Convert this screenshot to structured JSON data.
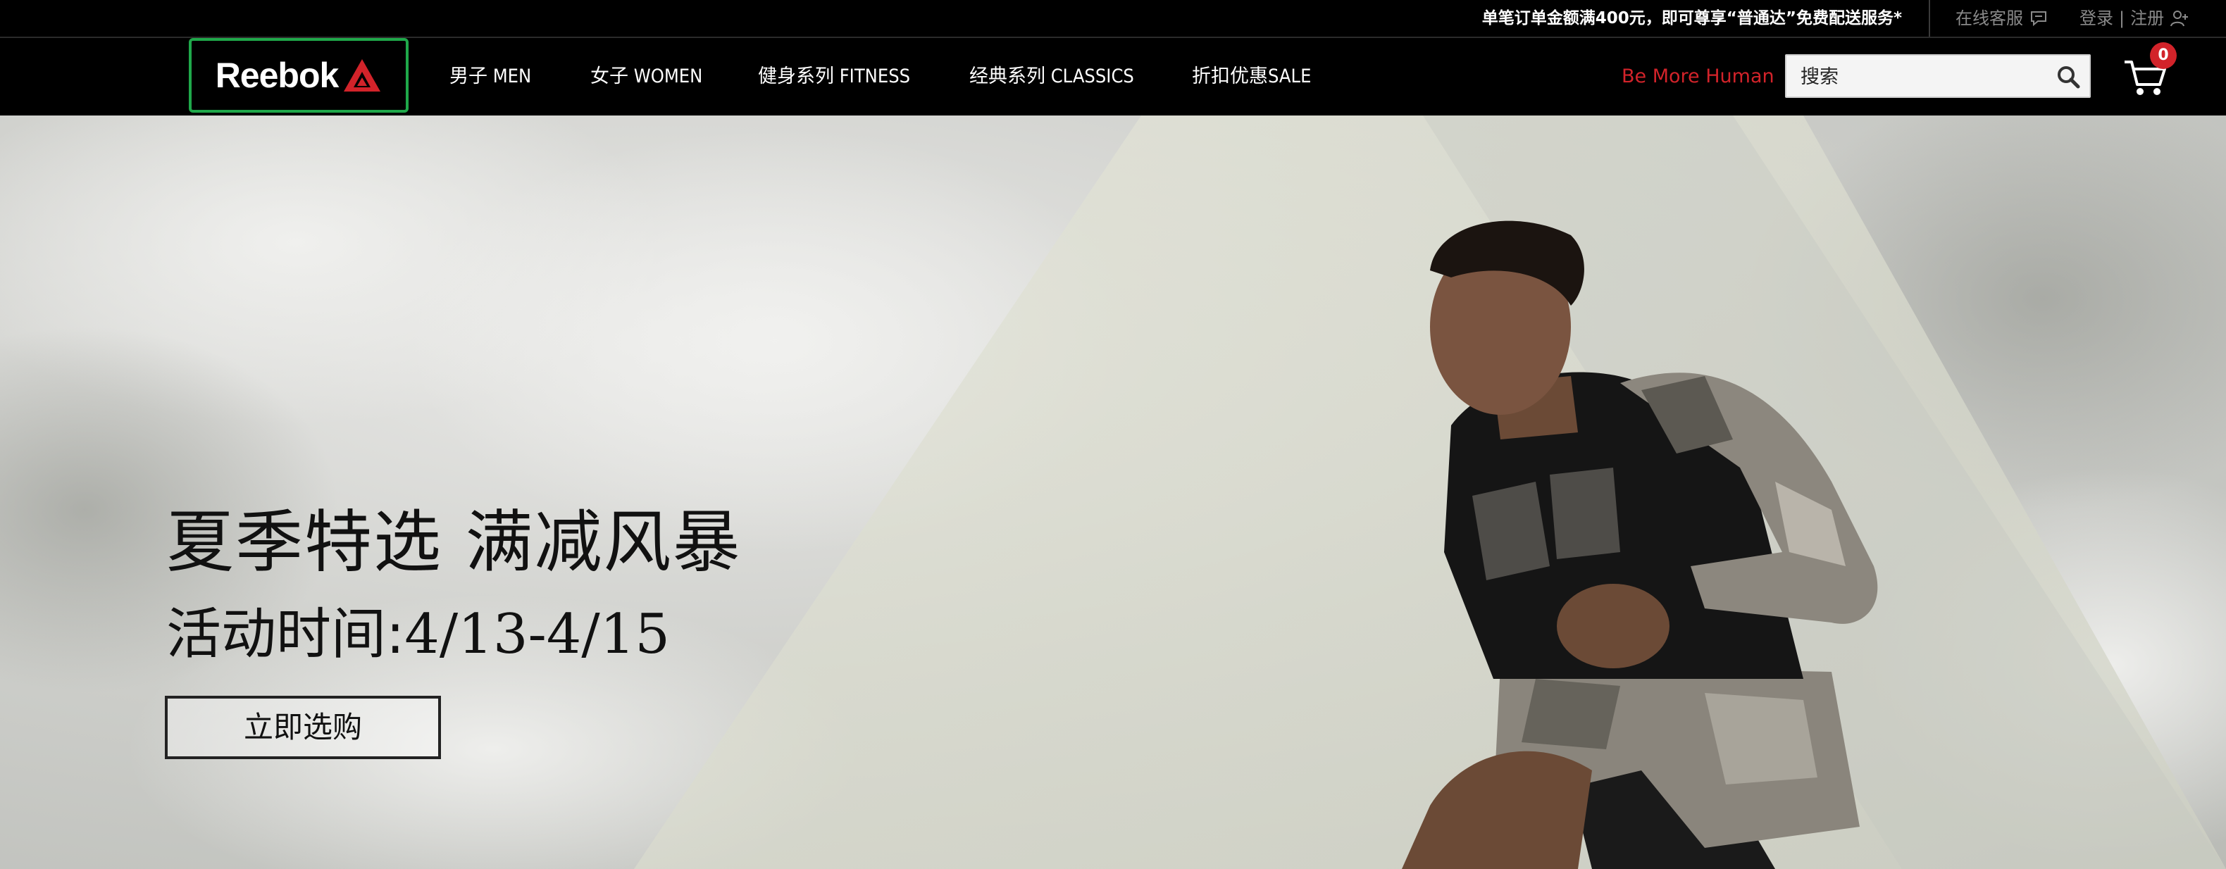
{
  "topbar": {
    "promo": "单笔订单金额满400元，即可尊享“普通达”免费配送服务*",
    "service": "在线客服",
    "login": "登录",
    "separator": "|",
    "register": "注册"
  },
  "nav": {
    "logo": "Reebok",
    "items": [
      {
        "label": "男子 MEN"
      },
      {
        "label": "女子 WOMEN"
      },
      {
        "label": "健身系列 FITNESS"
      },
      {
        "label": "经典系列 CLASSICS"
      },
      {
        "label": "折扣优惠SALE"
      }
    ],
    "tagline": "Be More Human",
    "search_placeholder": "搜索",
    "cart_count": "0"
  },
  "hero": {
    "headline": "夏季特选 满减风暴",
    "dates_prefix": "活动时间:",
    "dates_range": "4/13-4/15",
    "cta": "立即选购"
  },
  "colors": {
    "brand_red": "#d2232a",
    "logo_border": "#1fa84a",
    "bar_bg": "#000000"
  }
}
